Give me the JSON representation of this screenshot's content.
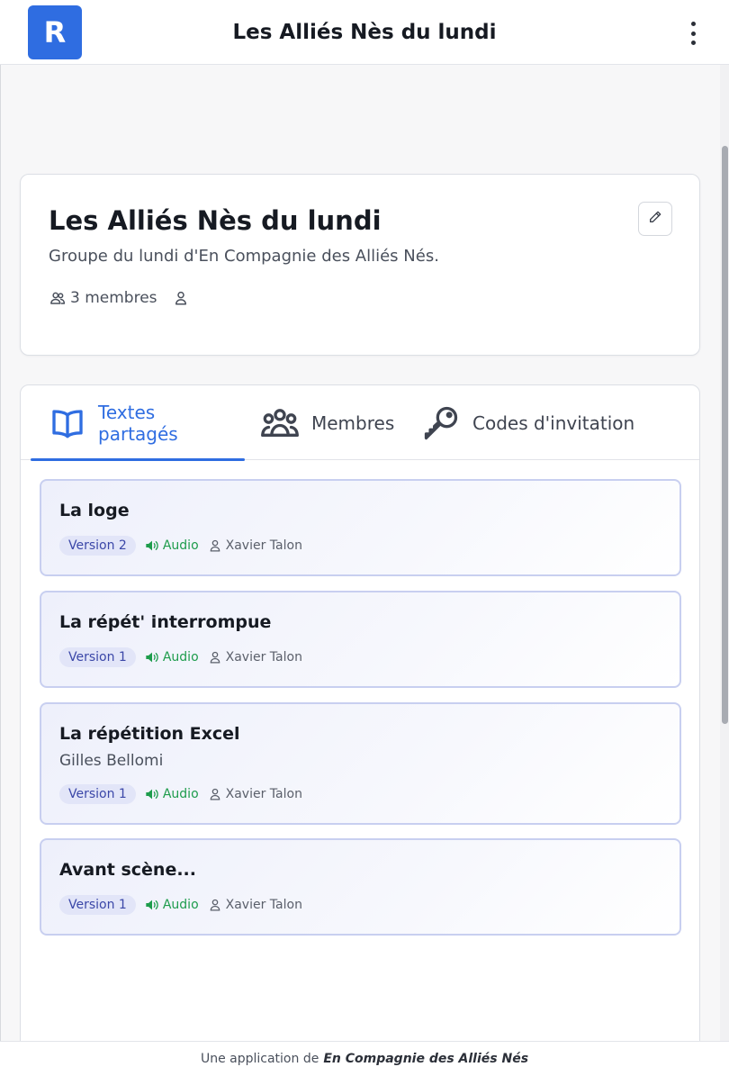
{
  "header": {
    "logo_letter": "R",
    "title": "Les Alliés Nès du lundi",
    "brand_color": "#2f6de1"
  },
  "group": {
    "name": "Les Alliés Nès du lundi",
    "description": "Groupe du lundi d'En Compagnie des Alliés Nés.",
    "member_count": "3 membres",
    "icons": [
      "users-icon",
      "user-icon",
      "pencil-icon"
    ]
  },
  "tabs": [
    {
      "label": "Textes partagés",
      "icon": "book-icon",
      "active": true
    },
    {
      "label": "Membres",
      "icon": "users-icon",
      "active": false
    },
    {
      "label": "Codes d'invitation",
      "icon": "key-icon",
      "active": false
    }
  ],
  "texts": [
    {
      "title": "La loge",
      "author": "",
      "version": "Version 2",
      "audio": "Audio",
      "owner": "Xavier Talon"
    },
    {
      "title": "La répét' interrompue",
      "author": "",
      "version": "Version 1",
      "audio": "Audio",
      "owner": "Xavier Talon"
    },
    {
      "title": "La répétition Excel",
      "author": "Gilles Bellomi",
      "version": "Version 1",
      "audio": "Audio",
      "owner": "Xavier Talon"
    },
    {
      "title": "Avant scène...",
      "author": "",
      "version": "Version 1",
      "audio": "Audio",
      "owner": "Xavier Talon"
    }
  ],
  "footer": {
    "prefix": "Une application de",
    "brand": "En Compagnie des Alliés Nés"
  },
  "colors": {
    "accent": "#2f6de1",
    "audio": "#1e9c4c",
    "version_badge_bg": "#e2e5f8",
    "version_badge_text": "#3b47a8"
  }
}
